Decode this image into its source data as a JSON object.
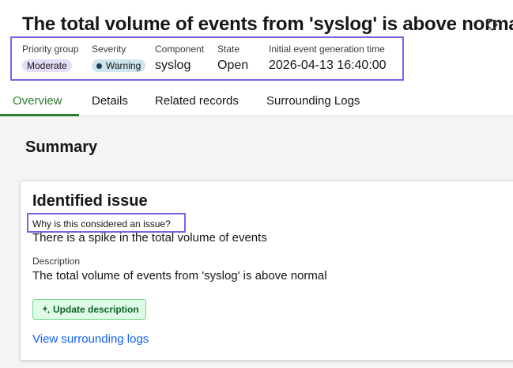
{
  "header": {
    "title": "The total volume of events from 'syslog' is above normal"
  },
  "meta": {
    "priority_group": {
      "label": "Priority group",
      "value": "Moderate"
    },
    "severity": {
      "label": "Severity",
      "value": "Warning"
    },
    "component": {
      "label": "Component",
      "value": "syslog"
    },
    "state": {
      "label": "State",
      "value": "Open"
    },
    "initial_event_time": {
      "label": "Initial event generation time",
      "value": "2026-04-13 16:40:00"
    }
  },
  "tabs": [
    {
      "label": "Overview",
      "active": true
    },
    {
      "label": "Details",
      "active": false
    },
    {
      "label": "Related records",
      "active": false
    },
    {
      "label": "Surrounding Logs",
      "active": false
    }
  ],
  "summary": {
    "heading": "Summary",
    "card": {
      "title": "Identified issue",
      "why_label": "Why is this considered an issue?",
      "why_value": "There is a spike in the total volume of events",
      "description_label": "Description",
      "description_value": "The total volume of events from 'syslog' is above normal",
      "update_button_label": "Update description",
      "view_logs_link": "View surrounding logs"
    }
  },
  "colors": {
    "accent_green": "#2e7d32",
    "highlight_purple": "#7b61e8",
    "link_blue": "#0f62fe",
    "priority_badge_bg": "#e5dcf7",
    "severity_badge_bg": "#cfe4ec"
  },
  "icons": {
    "tag": "tag-icon",
    "update": "sparkle-icon"
  }
}
